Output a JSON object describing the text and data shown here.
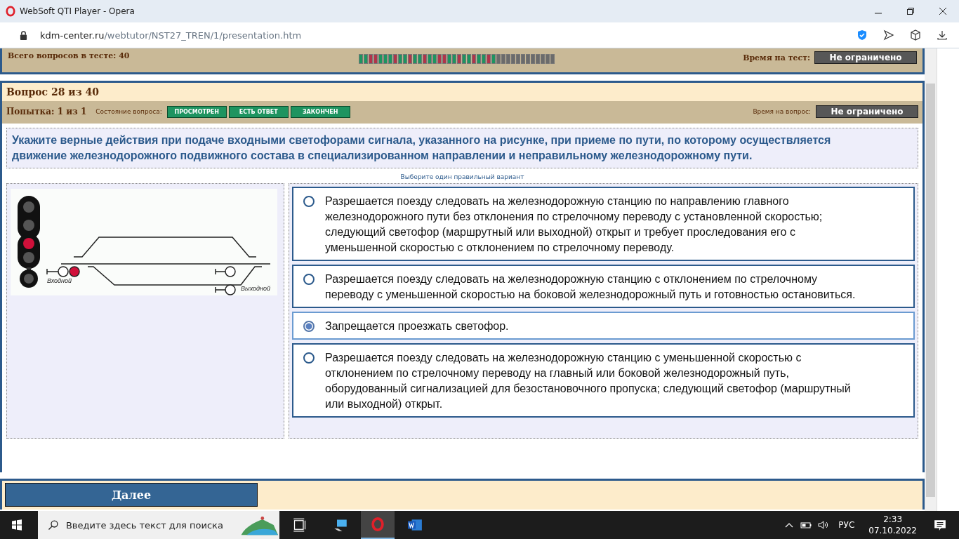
{
  "window": {
    "title": "WebSoft QTI Player - Opera"
  },
  "address_bar": {
    "host": "kdm-center.ru",
    "path": "/webtutor/NST27_TREN/1/presentation.htm"
  },
  "test_panel": {
    "total_label": "Всего вопросов в тесте: 40",
    "time_label": "Время на тест:",
    "time_value": "Не ограничено",
    "progress": [
      {
        "color": "#1e9460"
      },
      {
        "color": "#1e9460"
      },
      {
        "color": "#b0354a"
      },
      {
        "color": "#b0354a"
      },
      {
        "color": "#1e9460"
      },
      {
        "color": "#1e9460"
      },
      {
        "color": "#1e9460"
      },
      {
        "color": "#b0354a"
      },
      {
        "color": "#1e9460"
      },
      {
        "color": "#1e9460"
      },
      {
        "color": "#b0354a"
      },
      {
        "color": "#1e9460"
      },
      {
        "color": "#1e9460"
      },
      {
        "color": "#b0354a"
      },
      {
        "color": "#1e9460"
      },
      {
        "color": "#1e9460"
      },
      {
        "color": "#b0354a"
      },
      {
        "color": "#b0354a"
      },
      {
        "color": "#1e9460"
      },
      {
        "color": "#1e9460"
      },
      {
        "color": "#b0354a"
      },
      {
        "color": "#1e9460"
      },
      {
        "color": "#1e9460"
      },
      {
        "color": "#b0354a"
      },
      {
        "color": "#1e9460"
      },
      {
        "color": "#1e9460"
      },
      {
        "color": "#b0354a"
      },
      {
        "color": "#1e9460"
      },
      {
        "color": "#6b6b6b"
      },
      {
        "color": "#6b6b6b"
      },
      {
        "color": "#6b6b6b"
      },
      {
        "color": "#6b6b6b"
      },
      {
        "color": "#6b6b6b"
      },
      {
        "color": "#6b6b6b"
      },
      {
        "color": "#6b6b6b"
      },
      {
        "color": "#6b6b6b"
      },
      {
        "color": "#6b6b6b"
      },
      {
        "color": "#6b6b6b"
      },
      {
        "color": "#6b6b6b"
      },
      {
        "color": "#6b6b6b"
      }
    ]
  },
  "question_header": {
    "title": "Вопрос 28 из 40",
    "attempt": "Попытка: 1 из 1",
    "state_label": "Состояние вопроса:",
    "states": [
      "ПРОСМОТРЕН",
      "ЕСТЬ ОТВЕТ",
      "ЗАКОНЧЕН"
    ],
    "time_label": "Время на вопрос:",
    "time_value": "Не ограничено"
  },
  "question": {
    "text": "Укажите верные действия при подаче входными светофорами сигнала, указанного на рисунке, при приеме по пути, по которому осуществляется движение железнодорожного подвижного состава в специализированном направлении и неправильному железнодорожному пути.",
    "hint": "Выберите один правильный вариант",
    "figure": {
      "entry_label": "Входной",
      "exit_label": "Выходной"
    },
    "options": [
      {
        "text": "Разрешается поезду следовать на железнодорожную станцию по направлению главного железнодорожного пути без отклонения по стрелочному переводу с установленной скоростью; следующий светофор (маршрутный или выходной) открыт и требует проследования его с уменьшенной скоростью с отклонением по стрелочному переводу.",
        "selected": false
      },
      {
        "text": "Разрешается поезду следовать на железнодорожную станцию с отклонением по стрелочному переводу с уменьшенной скоростью на боковой железнодорожный путь и готовностью остановиться.",
        "selected": false
      },
      {
        "text": "Запрещается проезжать светофор.",
        "selected": true
      },
      {
        "text": "Разрешается поезду следовать на железнодорожную станцию с уменьшенной скоростью с отклонением по стрелочному переводу на главный или боковой железнодорожный путь, оборудованный сигнализацией для безостановочного пропуска; следующий светофор (маршрутный или выходной) открыт.",
        "selected": false
      }
    ]
  },
  "footer": {
    "next_button": "Далее"
  },
  "taskbar": {
    "search_placeholder": "Введите здесь текст для поиска",
    "language": "РУС",
    "time": "2:33",
    "date": "07.10.2022"
  }
}
